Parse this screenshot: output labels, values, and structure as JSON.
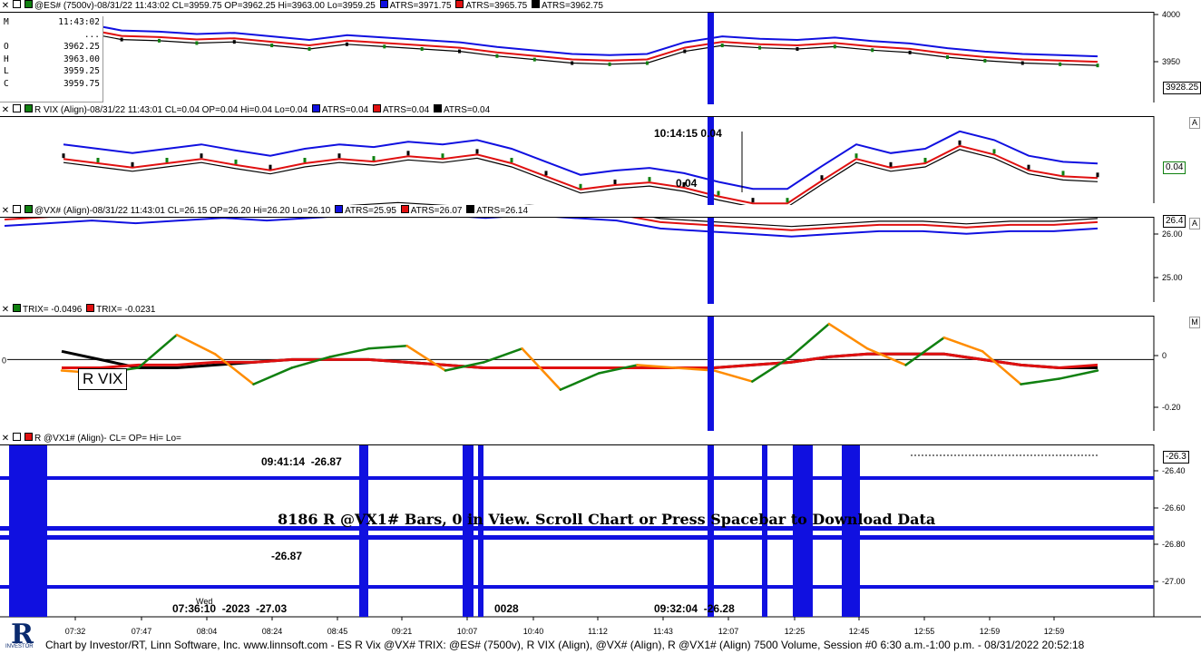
{
  "panels": [
    {
      "header": "@ES# (7500v)-08/31/22 11:43:02 CL=3959.75 OP=3962.25 Hi=3963.00 Lo=3959.25",
      "legend": [
        {
          "label": "ATRS=3971.75",
          "color": "#1010e0"
        },
        {
          "label": "ATRS=3965.75",
          "color": "#e01010"
        },
        {
          "label": "ATRS=3962.75",
          "color": "#000000"
        }
      ],
      "letter": "",
      "ticks": [
        "4000",
        "3950"
      ],
      "last_value": "3928.25"
    },
    {
      "header": "R VIX (Align)-08/31/22 11:43:01 CL=0.04 OP=0.04 Hi=0.04 Lo=0.04",
      "legend": [
        {
          "label": "ATRS=0.04",
          "color": "#1010e0"
        },
        {
          "label": "ATRS=0.04",
          "color": "#e01010"
        },
        {
          "label": "ATRS=0.04",
          "color": "#000000"
        }
      ],
      "letter": "A",
      "ticks": [],
      "last_value": "0.04"
    },
    {
      "header": "@VX# (Align)-08/31/22 11:43:01 CL=26.15 OP=26.20 Hi=26.20 Lo=26.10",
      "legend": [
        {
          "label": "ATRS=25.95",
          "color": "#1010e0"
        },
        {
          "label": "ATRS=26.07",
          "color": "#e01010"
        },
        {
          "label": "ATRS=26.14",
          "color": "#000000"
        }
      ],
      "letter": "A",
      "ticks": [
        "26.00",
        "25.00"
      ],
      "last_value": "26.4"
    },
    {
      "header": "",
      "legend": [
        {
          "label": "TRIX= -0.0496",
          "color": "#108010"
        },
        {
          "label": "TRIX= -0.0231",
          "color": "#e01010"
        }
      ],
      "letter": "M",
      "ticks": [
        "0",
        "-0.20"
      ],
      "left_tick": "0",
      "tag": "R VIX"
    },
    {
      "header": "R @VX1# (Align)- CL= OP= Hi= Lo=",
      "legend": [],
      "letter": "",
      "ticks": [
        "-26.40",
        "-26.60",
        "-26.80",
        "-27.00"
      ],
      "last_value": "-26.3"
    }
  ],
  "readout": [
    {
      "k": "M",
      "v": "11:43:02"
    },
    {
      "k": "",
      "v": "..."
    },
    {
      "k": "O",
      "v": "3962.25"
    },
    {
      "k": "H",
      "v": "3963.00"
    },
    {
      "k": "L",
      "v": "3959.25"
    },
    {
      "k": "C",
      "v": "3959.75"
    }
  ],
  "annotations": {
    "vix_time": "10:14:15",
    "vix_val": "0.04",
    "vix_low": "0.04",
    "vx1_a": "09:41:14",
    "vx1_b": "-26.87",
    "vx1_c": "-26.87",
    "vx1_d": "07:36:10",
    "vx1_e": "-27.03",
    "vx1_f": "09:32:04",
    "vx1_g": "-26.28",
    "vx1_h": "-2023",
    "vx1_i": "0028",
    "vx1_wed": "Wed",
    "message": "8186 R @VX1# Bars, 0 in View. Scroll Chart or  Press Spacebar to Download Data"
  },
  "chart_data": {
    "type": "line",
    "x_labels": [
      "07:32",
      "07:47",
      "08:04",
      "08:24",
      "08:45",
      "09:21",
      "10:07",
      "10:40",
      "11:12",
      "11:43",
      "12:07",
      "12:25",
      "12:45",
      "12:55",
      "12:59",
      "12:59"
    ],
    "series": [
      {
        "name": "TRIX -0.0496",
        "panel": "TRIX",
        "color": "#108010",
        "values": [
          -0.04,
          -0.05,
          -0.03,
          0.09,
          0.02,
          -0.09,
          -0.03,
          0.01,
          0.04,
          0.05,
          -0.04,
          -0.01,
          0.04,
          -0.11,
          -0.05,
          -0.02,
          -0.03,
          -0.04,
          -0.08,
          0.01,
          0.13,
          0.04,
          -0.02,
          0.08,
          0.03,
          -0.09,
          -0.07,
          -0.04
        ]
      },
      {
        "name": "TRIX -0.0231",
        "panel": "TRIX",
        "color": "#e01010",
        "values": [
          -0.03,
          -0.03,
          -0.02,
          -0.02,
          -0.01,
          -0.01,
          0.0,
          0.0,
          0.0,
          -0.01,
          -0.02,
          -0.03,
          -0.03,
          -0.03,
          -0.03,
          -0.03,
          -0.03,
          -0.03,
          -0.02,
          -0.01,
          0.01,
          0.02,
          0.02,
          0.02,
          0.0,
          -0.02,
          -0.03,
          -0.02
        ]
      },
      {
        "name": "",
        "panel": "TRIX",
        "color": "#000000",
        "values": [
          0.03,
          0.0,
          -0.03,
          -0.03,
          -0.02,
          -0.01,
          0.0,
          0.0,
          0.0,
          -0.01,
          -0.02,
          -0.03,
          -0.03,
          -0.03,
          -0.03,
          -0.03,
          -0.03,
          -0.03,
          -0.02,
          -0.01,
          0.01,
          0.02,
          0.02,
          0.02,
          0.0,
          -0.02,
          -0.03,
          -0.03
        ]
      }
    ],
    "es_close": [
      3985,
      3983,
      3986,
      3980,
      3979,
      3977,
      3978,
      3975,
      3972,
      3976,
      3974,
      3972,
      3970,
      3966,
      3963,
      3960,
      3959,
      3960,
      3970,
      3975,
      3973,
      3972,
      3974,
      3971,
      3969,
      3965,
      3962,
      3960,
      3959,
      3958
    ],
    "vix_close": [
      0.55,
      0.5,
      0.45,
      0.5,
      0.55,
      0.48,
      0.42,
      0.5,
      0.55,
      0.52,
      0.58,
      0.55,
      0.6,
      0.5,
      0.35,
      0.2,
      0.25,
      0.28,
      0.22,
      0.12,
      0.04,
      0.04,
      0.3,
      0.55,
      0.45,
      0.5,
      0.7,
      0.6,
      0.42,
      0.35,
      0.33
    ],
    "vx_close": [
      26.4,
      26.45,
      26.5,
      26.45,
      26.5,
      26.55,
      26.5,
      26.55,
      26.6,
      26.65,
      26.6,
      26.55,
      26.6,
      26.55,
      26.5,
      26.35,
      26.3,
      26.25,
      26.2,
      26.25,
      26.3,
      26.3,
      26.25,
      26.3,
      26.3,
      26.35
    ],
    "ylim_es": [
      3925,
      4002
    ],
    "ylim_vx": [
      24.8,
      26.4
    ],
    "ylim_trix": [
      -0.26,
      0.16
    ],
    "ylim_vx1": [
      -27.15,
      -26.3
    ]
  },
  "footer": "Chart by Investor/RT, Linn Software, Inc. www.linnsoft.com - ES R Vix @VX# TRIX: @ES# (7500v), R VIX (Align), @VX# (Align), R @VX1# (Align) 7500 Volume, Session #0 6:30 a.m.-1:00 p.m. - 08/31/2022 20:52:18",
  "logo": {
    "letter": "R",
    "text": "INVESTOR"
  },
  "colors": {
    "blue": "#1010e0",
    "red": "#e01010",
    "green": "#108010",
    "orange": "#ff8c00",
    "selection": "#1010e0"
  }
}
